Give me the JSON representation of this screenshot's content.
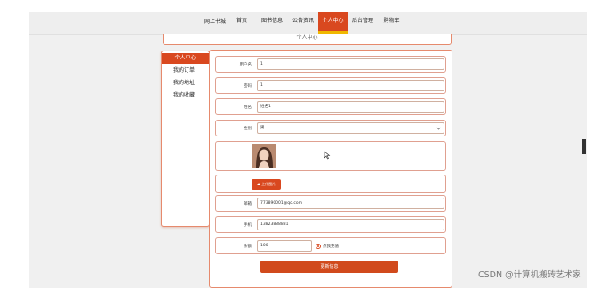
{
  "nav": {
    "brand": "网上书城",
    "items": [
      "首页",
      "图书信息",
      "公告资讯",
      "个人中心",
      "后台管理",
      "购物车"
    ],
    "active_index": 3
  },
  "header": {
    "title": "个人中心"
  },
  "sidebar": {
    "items": [
      "个人中心",
      "我的订单",
      "我的地址",
      "我的收藏"
    ],
    "active_index": 0
  },
  "form": {
    "username": {
      "label": "用户名",
      "value": "1"
    },
    "password": {
      "label": "密码",
      "value": "1"
    },
    "name": {
      "label": "姓名",
      "value": "姓名1"
    },
    "gender": {
      "label": "性别",
      "value": "男"
    },
    "upload_label": "上传图片",
    "email": {
      "label": "邮箱",
      "value": "773890001@qq.com"
    },
    "phone": {
      "label": "手机",
      "value": "13823888881"
    },
    "balance": {
      "label": "余额",
      "value": "100",
      "recharge_label": "点我充值"
    },
    "submit_label": "更新信息"
  },
  "watermark": "CSDN @计算机搬砖艺术家",
  "colors": {
    "accent": "#d9481f",
    "highlight": "#f0b800"
  }
}
